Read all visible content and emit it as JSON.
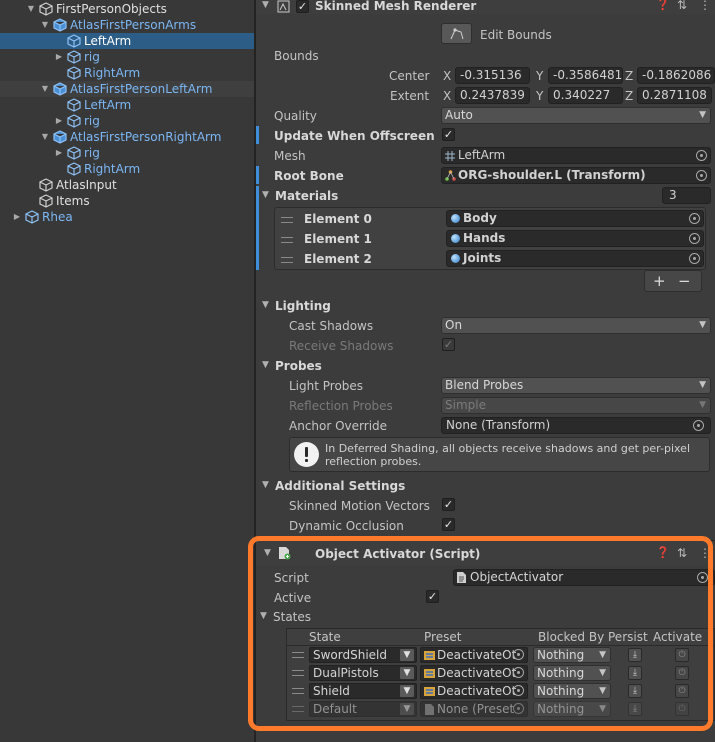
{
  "hierarchy": {
    "items": [
      {
        "label": "FirstPersonObjects",
        "depth": 1,
        "arrow": "down",
        "color": "white"
      },
      {
        "label": "AtlasFirstPersonArms",
        "depth": 2,
        "arrow": "down",
        "color": "blue"
      },
      {
        "label": "LeftArm",
        "depth": 3,
        "arrow": "",
        "color": "blue",
        "selected": true
      },
      {
        "label": "rig",
        "depth": 3,
        "arrow": "right",
        "color": "blue"
      },
      {
        "label": "RightArm",
        "depth": 3,
        "arrow": "",
        "color": "blue"
      },
      {
        "label": "AtlasFirstPersonLeftArm",
        "depth": 2,
        "arrow": "down",
        "color": "blue",
        "alt": true
      },
      {
        "label": "LeftArm",
        "depth": 3,
        "arrow": "",
        "color": "blue"
      },
      {
        "label": "rig",
        "depth": 3,
        "arrow": "right",
        "color": "blue"
      },
      {
        "label": "AtlasFirstPersonRightArm",
        "depth": 2,
        "arrow": "down",
        "color": "blue"
      },
      {
        "label": "rig",
        "depth": 3,
        "arrow": "right",
        "color": "blue"
      },
      {
        "label": "RightArm",
        "depth": 3,
        "arrow": "",
        "color": "blue"
      },
      {
        "label": "AtlasInput",
        "depth": 1,
        "arrow": "",
        "color": "white"
      },
      {
        "label": "Items",
        "depth": 1,
        "arrow": "",
        "color": "white"
      },
      {
        "label": "Rhea",
        "depth": 0,
        "arrow": "right",
        "color": "blue"
      }
    ]
  },
  "skinned": {
    "title": "Skinned Mesh Renderer",
    "edit_bounds": "Edit Bounds",
    "bounds_label": "Bounds",
    "center_label": "Center",
    "extent_label": "Extent",
    "x": "X",
    "y": "Y",
    "z": "Z",
    "center": {
      "x": "-0.315136",
      "y": "-0.3586481",
      "z": "-0.1862086"
    },
    "extent": {
      "x": "0.2437839",
      "y": "0.340227",
      "z": "0.2871108"
    },
    "quality_label": "Quality",
    "quality_value": "Auto",
    "update_offscreen_label": "Update When Offscreen",
    "mesh_label": "Mesh",
    "mesh_value": "LeftArm",
    "root_bone_label": "Root Bone",
    "root_bone_value": "ORG-shoulder.L (Transform)",
    "materials_label": "Materials",
    "materials_count": "3",
    "elements": [
      {
        "label": "Element 0",
        "value": "Body"
      },
      {
        "label": "Element 1",
        "value": "Hands"
      },
      {
        "label": "Element 2",
        "value": "Joints"
      }
    ],
    "plus": "+",
    "minus": "−",
    "lighting_label": "Lighting",
    "cast_shadows_label": "Cast Shadows",
    "cast_shadows_value": "On",
    "receive_shadows_label": "Receive Shadows",
    "probes_label": "Probes",
    "light_probes_label": "Light Probes",
    "light_probes_value": "Blend Probes",
    "reflection_probes_label": "Reflection Probes",
    "reflection_probes_value": "Simple",
    "anchor_override_label": "Anchor Override",
    "anchor_override_value": "None (Transform)",
    "help_text": "In Deferred Shading, all objects receive shadows and get per-pixel reflection probes.",
    "additional_label": "Additional Settings",
    "motion_vectors_label": "Skinned Motion Vectors",
    "dynamic_occlusion_label": "Dynamic Occlusion"
  },
  "activator": {
    "title": "Object Activator (Script)",
    "script_label": "Script",
    "script_value": "ObjectActivator",
    "active_label": "Active",
    "states_label": "States",
    "columns": [
      "State",
      "Preset",
      "Blocked By",
      "Persist",
      "Activate"
    ],
    "rows": [
      {
        "state": "SwordShield",
        "preset": "DeactivateOt",
        "blocked": "Nothing"
      },
      {
        "state": "DualPistols",
        "preset": "DeactivateOt",
        "blocked": "Nothing"
      },
      {
        "state": "Shield",
        "preset": "DeactivateOt",
        "blocked": "Nothing"
      },
      {
        "state": "Default",
        "preset": "None (Preset",
        "blocked": "Nothing",
        "disabled": true
      }
    ]
  },
  "colors": {
    "highlight": "#ff7a2b",
    "selection": "#2c5d87",
    "prefab_blue": "#7bb7f5"
  }
}
